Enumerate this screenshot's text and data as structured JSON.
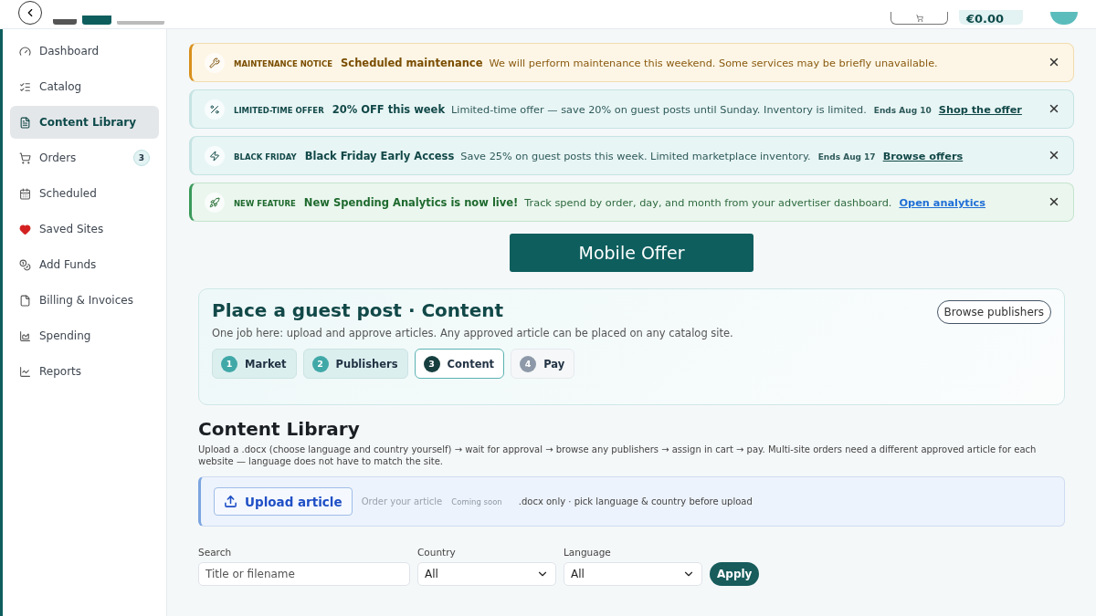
{
  "header": {
    "balance": "€0.00"
  },
  "sidebar": {
    "items": [
      {
        "label": "Dashboard",
        "selected": false
      },
      {
        "label": "Catalog",
        "selected": false
      },
      {
        "label": "Content Library",
        "selected": true
      },
      {
        "label": "Orders",
        "selected": false,
        "badge": "3"
      },
      {
        "label": "Scheduled",
        "selected": false
      },
      {
        "label": "Saved Sites",
        "selected": false
      },
      {
        "label": "Add Funds",
        "selected": false
      },
      {
        "label": "Billing & Invoices",
        "selected": false
      },
      {
        "label": "Spending",
        "selected": false
      },
      {
        "label": "Reports",
        "selected": false
      }
    ]
  },
  "notices": [
    {
      "kind": "warning",
      "tag": "MAINTENANCE NOTICE",
      "title": "Scheduled maintenance",
      "text": "We will perform maintenance this weekend. Some services may be briefly unavailable."
    },
    {
      "kind": "offer",
      "tag": "LIMITED-TIME OFFER",
      "title": "20% OFF this week",
      "text": "Limited-time offer — save 20% on guest posts until Sunday. Inventory is limited.",
      "ends": "Ends Aug 10",
      "link": "Shop the offer"
    },
    {
      "kind": "flash",
      "tag": "BLACK FRIDAY",
      "title": "Black Friday Early Access",
      "text": "Save 25% on guest posts this week. Limited marketplace inventory.",
      "ends": "Ends Aug 17",
      "link": "Browse offers"
    },
    {
      "kind": "feature",
      "tag": "NEW FEATURE",
      "title": "New Spending Analytics is now live!",
      "text": "Track spend by order, day, and month from your advertiser dashboard.",
      "link": "Open analytics"
    }
  ],
  "promo_button": "Mobile Offer",
  "guest_post": {
    "title": "Place a guest post · Content",
    "subtitle": "One job here: upload and approve articles. Any approved article can be placed on any catalog site.",
    "browse_button": "Browse publishers",
    "steps": [
      {
        "number": "1",
        "label": "Market",
        "done": true,
        "selected": false
      },
      {
        "number": "2",
        "label": "Publishers",
        "done": true,
        "selected": false
      },
      {
        "number": "3",
        "label": "Content",
        "done": false,
        "selected": true
      },
      {
        "number": "4",
        "label": "Pay",
        "done": false,
        "selected": false
      }
    ]
  },
  "library": {
    "title": "Content Library",
    "description": "Upload a .docx (choose language and country yourself) → wait for approval → browse any publishers → assign in cart → pay. Multi-site orders need a different approved article for each website — language does not have to match the site.",
    "upload_button": "Upload article",
    "order_link": "Order your article",
    "order_badge": "Coming soon",
    "hint": ".docx only · pick language & country before upload"
  },
  "filters": {
    "search_label": "Search",
    "search_placeholder": "Title or filename",
    "country_label": "Country",
    "country_value": "All",
    "language_label": "Language",
    "language_value": "All",
    "apply_button": "Apply"
  }
}
